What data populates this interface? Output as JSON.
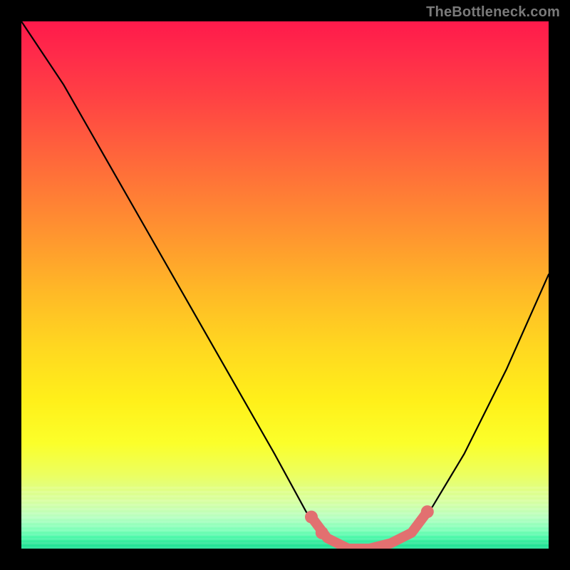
{
  "watermark": "TheBottleneck.com",
  "colors": {
    "background": "#000000",
    "curve": "#000000",
    "marker": "#e27070",
    "gradient_top": "#ff1a4b",
    "gradient_mid": "#ffd820",
    "gradient_bottom": "#1adf94"
  },
  "chart_data": {
    "type": "line",
    "title": "",
    "xlabel": "",
    "ylabel": "",
    "xlim": [
      0,
      100
    ],
    "ylim": [
      0,
      100
    ],
    "grid": false,
    "legend": false,
    "series": [
      {
        "name": "bottleneck-curve",
        "x": [
          0,
          8,
          16,
          24,
          32,
          40,
          48,
          54,
          58,
          60,
          62,
          66,
          70,
          74,
          78,
          84,
          92,
          100
        ],
        "values": [
          100,
          88,
          74,
          60,
          46,
          32,
          18,
          7,
          2,
          1,
          0,
          0,
          1,
          3,
          8,
          18,
          34,
          52
        ]
      }
    ],
    "highlighted_segment": {
      "name": "optimal-range",
      "x": [
        55,
        58,
        60,
        62,
        66,
        70,
        74,
        77
      ],
      "values": [
        6,
        2,
        1,
        0,
        0,
        1,
        3,
        7
      ]
    },
    "markers": [
      {
        "x": 55,
        "y": 6
      },
      {
        "x": 57,
        "y": 3
      },
      {
        "x": 77,
        "y": 7
      }
    ]
  }
}
